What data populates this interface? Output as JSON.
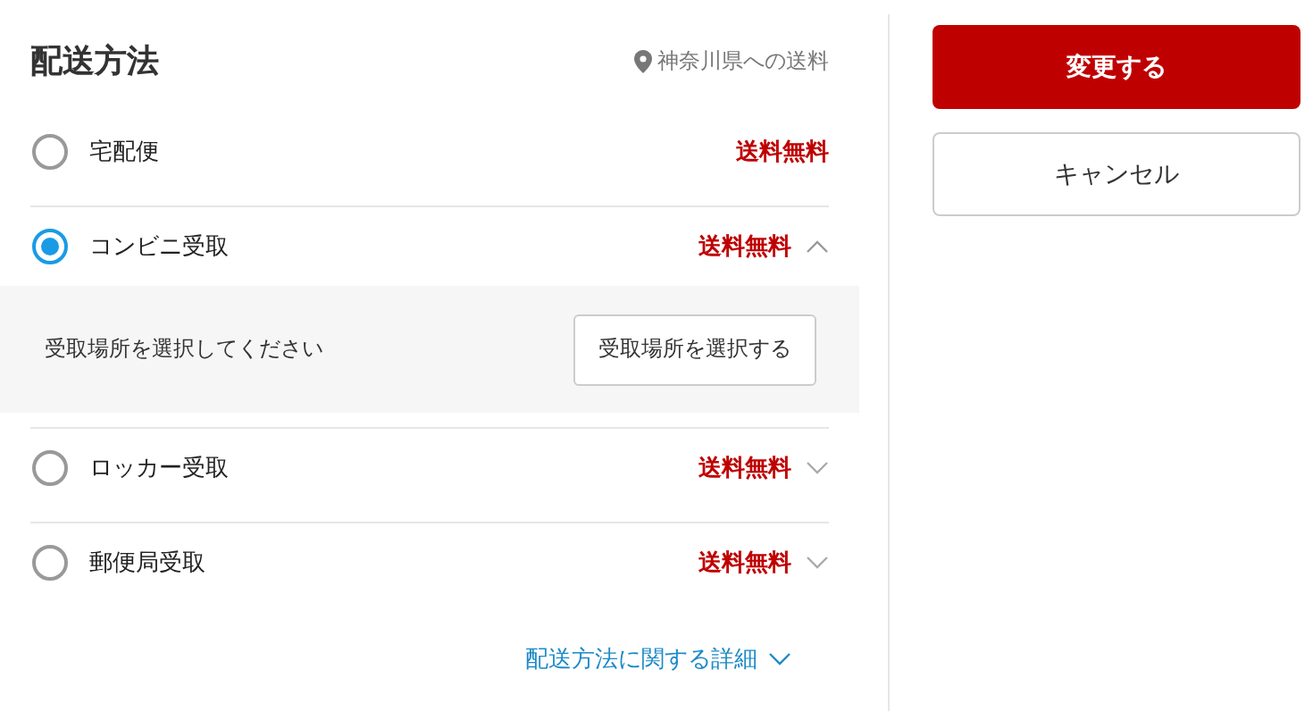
{
  "header": {
    "title": "配送方法",
    "destination": "神奈川県への送料"
  },
  "options": [
    {
      "label": "宅配便",
      "selected": false,
      "price": "送料無料"
    },
    {
      "label": "コンビニ受取",
      "selected": true,
      "price": "送料無料",
      "expanded": true,
      "detail": {
        "message": "受取場所を選択してください",
        "button": "受取場所を選択する"
      }
    },
    {
      "label": "ロッカー受取",
      "selected": false,
      "price": "送料無料",
      "expanded": false
    },
    {
      "label": "郵便局受取",
      "selected": false,
      "price": "送料無料",
      "expanded": false
    }
  ],
  "details_link": "配送方法に関する詳細",
  "actions": [
    {
      "label": "変更する",
      "kind": "primary"
    },
    {
      "label": "キャンセル",
      "kind": "secondary"
    }
  ]
}
